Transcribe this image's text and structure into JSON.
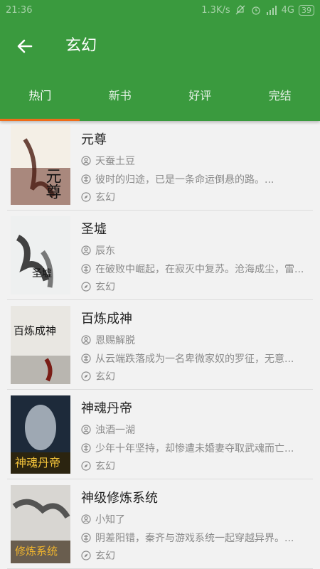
{
  "status": {
    "time": "21:36",
    "net_speed": "1.3K/s",
    "network": "4G",
    "battery": "39"
  },
  "toolbar": {
    "title": "玄幻"
  },
  "tabs": [
    {
      "label": "热门"
    },
    {
      "label": "新书"
    },
    {
      "label": "好评"
    },
    {
      "label": "完结"
    }
  ],
  "books": [
    {
      "title": "元尊",
      "author": "天蚕土豆",
      "desc": "彼时的归途，已是一条命运倒悬的路。...",
      "category": "玄幻",
      "cover_text": "元尊"
    },
    {
      "title": "圣墟",
      "author": "辰东",
      "desc": "在破败中崛起，在寂灭中复苏。沧海成尘，雷...",
      "category": "玄幻",
      "cover_text": "圣墟"
    },
    {
      "title": "百炼成神",
      "author": "恩赐解脱",
      "desc": "从云端跌落成为一名卑微家奴的罗征，无意...",
      "category": "玄幻",
      "cover_text": "百炼成神"
    },
    {
      "title": "神魂丹帝",
      "author": "浊酒一湖",
      "desc": "少年十年坚持，却惨遭未婚妻夺取武魂而亡...",
      "category": "玄幻",
      "cover_text": "神魂丹帝"
    },
    {
      "title": "神级修炼系统",
      "author": "小知了",
      "desc": "阴差阳错，秦齐与游戏系统一起穿越异界。...",
      "category": "玄幻",
      "cover_text": "修炼系统"
    }
  ]
}
